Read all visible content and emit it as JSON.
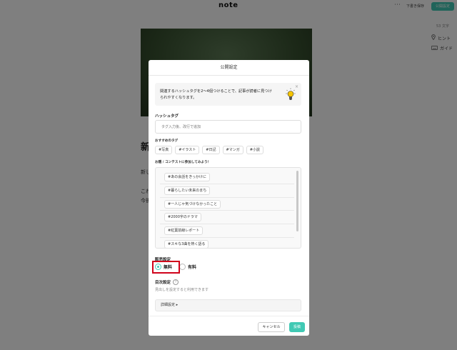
{
  "header": {
    "logo": "note",
    "more_icon": "more-dots-icon",
    "draft_save": "下書き保存",
    "publish_settings": "公開設定"
  },
  "editor": {
    "word_count": "53 文字",
    "hint": "ヒント",
    "guide": "ガイド",
    "title_fragment": "新",
    "line1_fragment": "新し",
    "line2_fragment": "これ",
    "line3_fragment": "今後"
  },
  "modal": {
    "title": "公開設定",
    "tip": {
      "text": "関連するハッシュタグを2〜4個つけることで、記事が読者に見つけられやすくなります。",
      "close": "×",
      "icon": "lightbulb-icon"
    },
    "hashtag": {
      "label": "ハッシュタグ",
      "placeholder": "タグ入力後、改行で追加"
    },
    "recommended": {
      "label": "おすすめのタグ",
      "tags": [
        "#写真",
        "#イラスト",
        "#日記",
        "#マンガ",
        "#小説"
      ]
    },
    "contest": {
      "label": "お題 / コンテストに参加してみよう！",
      "tags": [
        "#あの会話をきっかけに",
        "#暮らしたい未来のまち",
        "#一人じゃ気づけなかったこと",
        "#2000字のドラマ",
        "#紅葉前線レポート",
        "#スキな3曲を熱く語る"
      ]
    },
    "price": {
      "label": "販売設定",
      "free": "無料",
      "paid": "有料",
      "selected": "無料"
    },
    "toc": {
      "label": "目次設定",
      "help": "?",
      "desc": "見出しを設定すると利用できます"
    },
    "advanced": "詳細設定 ▸",
    "cancel": "キャンセル",
    "submit": "投稿"
  },
  "colors": {
    "accent": "#41c9b4",
    "highlight": "#d0021b"
  }
}
